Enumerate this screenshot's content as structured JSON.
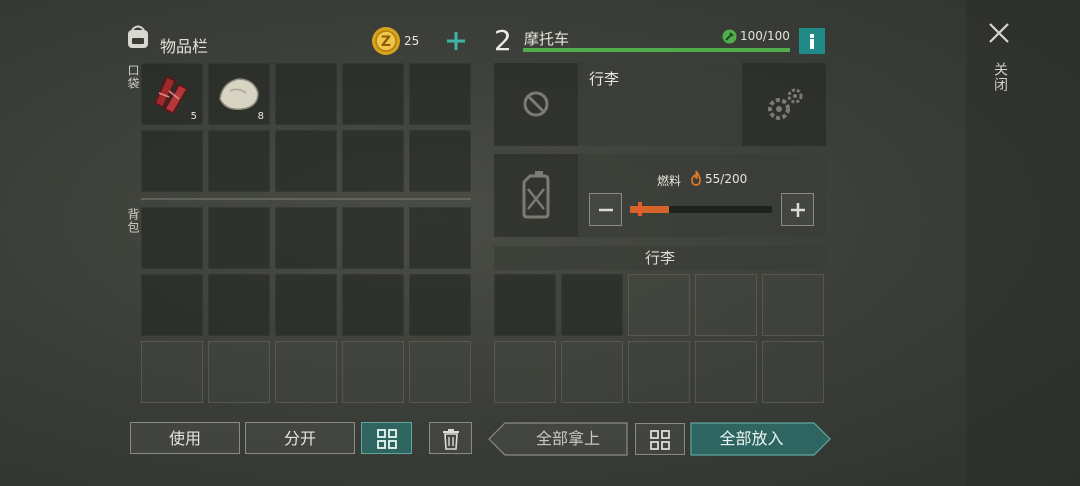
{
  "inventory": {
    "title": "物品栏",
    "coins": "25",
    "pocket_label": "口袋",
    "backpack_label": "背包",
    "items": [
      {
        "name": "meat",
        "count": "5"
      },
      {
        "name": "stone",
        "count": "8"
      }
    ]
  },
  "vehicle": {
    "number": "2",
    "name": "摩托车",
    "durability": "100/100",
    "durability_fraction": 1.0,
    "trunk_label": "行李",
    "fuel_label": "燃料",
    "fuel_value": "55/200",
    "fuel_fraction": 0.275,
    "cargo_title": "行李"
  },
  "buttons": {
    "use": "使用",
    "split": "分开",
    "take_all": "全部拿上",
    "put_all": "全部放入"
  },
  "close_label": "关闭",
  "colors": {
    "accent_teal": "#2e6560",
    "durability_green": "#4fae4b",
    "fuel_orange": "#d4642a",
    "info_teal": "#1f8a86"
  }
}
